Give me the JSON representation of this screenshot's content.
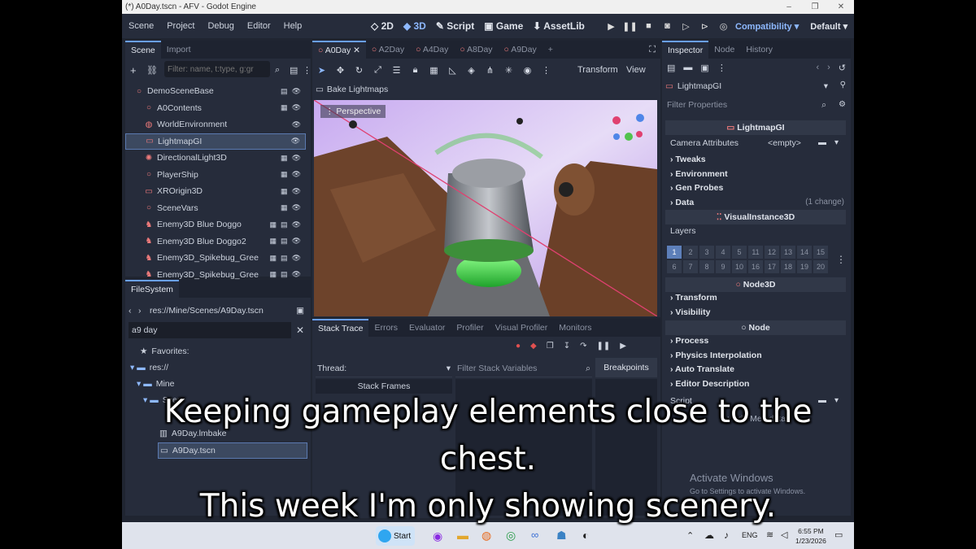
{
  "window": {
    "title": "(*) A0Day.tscn - AFV - Godot Engine",
    "controls": [
      "–",
      "❐",
      "✕"
    ]
  },
  "menu": [
    "Scene",
    "Project",
    "Debug",
    "Editor",
    "Help"
  ],
  "workspaces": [
    {
      "label": "2D"
    },
    {
      "label": "3D"
    },
    {
      "label": "Script"
    },
    {
      "label": "Game"
    },
    {
      "label": "AssetLib"
    }
  ],
  "renderer": {
    "mode": "Compatibility",
    "layout": "Default"
  },
  "scene_dock": {
    "tabs": [
      "Scene",
      "Import"
    ],
    "filter_placeholder": "Filter: name, t:type, g:gr",
    "nodes": [
      {
        "name": "DemoSceneBase",
        "icon": "○",
        "color": "#f27c7c"
      },
      {
        "name": "A0Contents",
        "icon": "○",
        "color": "#f27c7c"
      },
      {
        "name": "WorldEnvironment",
        "icon": "◍",
        "color": "#f27c7c"
      },
      {
        "name": "LightmapGI",
        "icon": "▭",
        "color": "#f27c7c"
      },
      {
        "name": "DirectionalLight3D",
        "icon": "✺",
        "color": "#f27c7c"
      },
      {
        "name": "PlayerShip",
        "icon": "○",
        "color": "#f27c7c"
      },
      {
        "name": "XROrigin3D",
        "icon": "▭",
        "color": "#f27c7c"
      },
      {
        "name": "SceneVars",
        "icon": "○",
        "color": "#f27c7c"
      },
      {
        "name": "Enemy3D Blue Doggo",
        "icon": "♞",
        "color": "#f27c7c"
      },
      {
        "name": "Enemy3D Blue Doggo2",
        "icon": "♞",
        "color": "#f27c7c"
      },
      {
        "name": "Enemy3D_Spikebug_Gree",
        "icon": "♞",
        "color": "#f27c7c"
      },
      {
        "name": "Enemy3D_Spikebug_Gree",
        "icon": "♞",
        "color": "#f27c7c"
      }
    ]
  },
  "filesystem": {
    "tab": "FileSystem",
    "path": "res://Mine/Scenes/A9Day.tscn",
    "search": "a9 day",
    "items": [
      {
        "label": "Favorites:"
      },
      {
        "label": "res://"
      },
      {
        "label": "Mine"
      },
      {
        "label": "Scer"
      },
      {
        "label": "A9Day.lmbake"
      },
      {
        "label": "A9Day.tscn"
      }
    ]
  },
  "viewport": {
    "tabs": [
      "A0Day",
      "A2Day",
      "A4Day",
      "A8Day",
      "A9Day"
    ],
    "transform": "Transform",
    "view": "View",
    "bake": "Bake Lightmaps",
    "perspective": "Perspective"
  },
  "bottom": {
    "tabs": [
      "Stack Trace",
      "Errors",
      "Evaluator",
      "Profiler",
      "Visual Profiler",
      "Monitors"
    ],
    "thread": "Thread:",
    "filter_placeholder": "Filter Stack Variables",
    "breakpoints": "Breakpoints",
    "stack_frames": "Stack Frames"
  },
  "inspector": {
    "tabs": [
      "Inspector",
      "Node",
      "History"
    ],
    "node": "LightmapGI",
    "filter": "Filter Properties",
    "sections": [
      {
        "label": "LightmapGI"
      },
      {
        "label": "VisualInstance3D"
      },
      {
        "label": "Node3D"
      },
      {
        "label": "Node"
      }
    ],
    "camera_attributes": "Camera Attributes",
    "camera_value": "<empty>",
    "props_a": [
      "Tweaks",
      "Environment",
      "Gen Probes",
      "Data"
    ],
    "data_change": "(1 change)",
    "layers_label": "Layers",
    "layers": [
      "1",
      "2",
      "3",
      "4",
      "5",
      "11",
      "12",
      "13",
      "14",
      "15",
      "6",
      "7",
      "8",
      "9",
      "10",
      "16",
      "17",
      "18",
      "19",
      "20"
    ],
    "props_b": [
      "Transform",
      "Visibility"
    ],
    "props_c": [
      "Process",
      "Physics Interpolation",
      "Auto Translate",
      "Editor Description"
    ],
    "script": "Script",
    "metadata": "Add Metadata"
  },
  "watermark": {
    "title": "Activate Windows",
    "sub": "Go to Settings to activate Windows."
  },
  "taskbar": {
    "start": "Start",
    "lang": "ENG",
    "time": "6:55 PM",
    "date": "1/23/2026"
  },
  "subtitles": [
    "Keeping gameplay elements close to the",
    "chest.",
    "This week I'm only showing scenery."
  ]
}
